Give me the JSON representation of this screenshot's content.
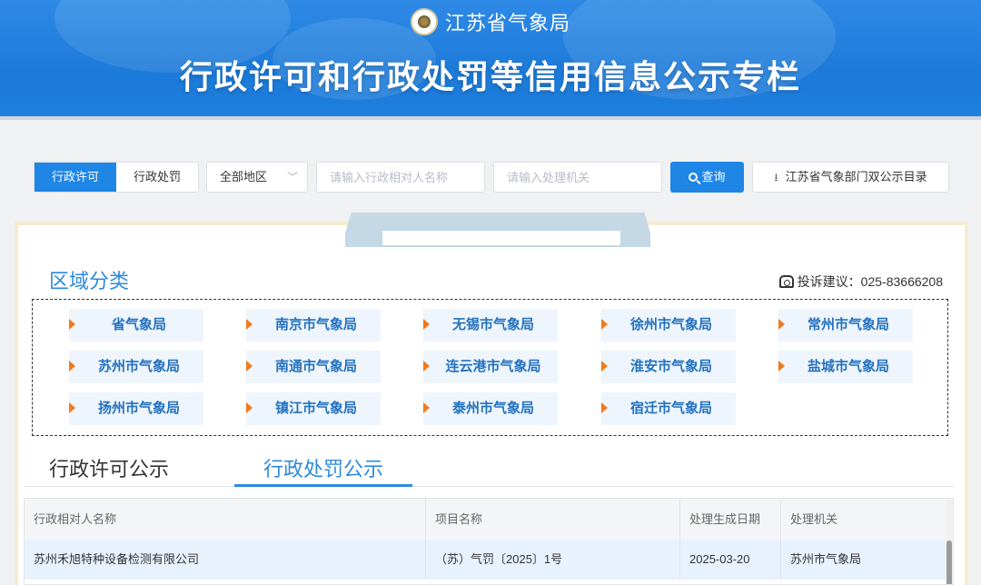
{
  "header": {
    "org_name": "江苏省气象局",
    "main_title": "行政许可和行政处罚等信用信息公示专栏"
  },
  "search": {
    "tabs": [
      {
        "label": "行政许可",
        "active": true
      },
      {
        "label": "行政处罚",
        "active": false
      }
    ],
    "region_select": "全部地区",
    "name_placeholder": "请输入行政相对人名称",
    "agency_placeholder": "请输入处理机关",
    "query_label": "查询",
    "download_label": "江苏省气象部门双公示目录"
  },
  "region_section": {
    "title": "区域分类",
    "complaint": "投诉建议：025-83666208",
    "items": [
      "省气象局",
      "南京市气象局",
      "无锡市气象局",
      "徐州市气象局",
      "常州市气象局",
      "苏州市气象局",
      "南通市气象局",
      "连云港市气象局",
      "淮安市气象局",
      "盐城市气象局",
      "扬州市气象局",
      "镇江市气象局",
      "泰州市气象局",
      "宿迁市气象局"
    ]
  },
  "public_tabs": [
    {
      "label": "行政许可公示",
      "active": false
    },
    {
      "label": "行政处罚公示",
      "active": true
    }
  ],
  "table": {
    "headers": [
      "行政相对人名称",
      "项目名称",
      "处理生成日期",
      "处理机关"
    ],
    "rows": [
      [
        "苏州禾旭特种设备检测有限公司",
        "（苏）气罚〔2025〕1号",
        "2025-03-20",
        "苏州市气象局"
      ]
    ]
  },
  "colors": {
    "primary": "#1f86e6",
    "accent_orange": "#f07a1c",
    "link_blue": "#2472bf"
  }
}
